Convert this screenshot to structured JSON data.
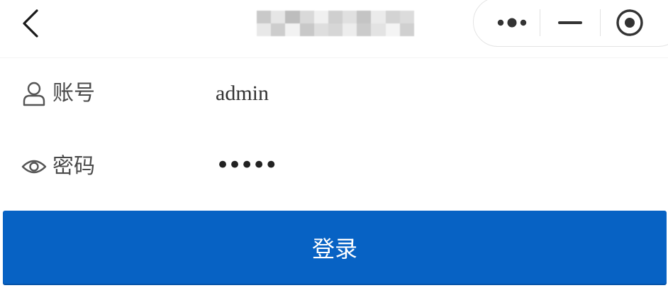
{
  "nav": {
    "back_icon": "chevron-left-icon",
    "title_obscured": true,
    "capsule": {
      "more_icon": "more-dots-icon",
      "minimize_icon": "minimize-icon",
      "close_icon": "target-circle-icon"
    }
  },
  "form": {
    "account": {
      "icon": "user-icon",
      "label": "账号",
      "value": "admin"
    },
    "password": {
      "icon": "eye-icon",
      "label": "密码",
      "masked_value": "•••••"
    }
  },
  "login_button": {
    "label": "登录"
  },
  "colors": {
    "primary": "#0762c4",
    "button_text": "#ffffff",
    "icon": "#555555"
  }
}
